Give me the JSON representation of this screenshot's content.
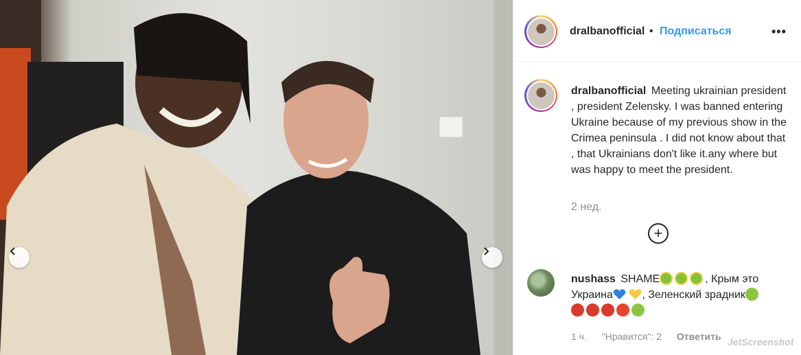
{
  "post": {
    "image_description_icon": "post-photo",
    "carousel": {
      "prev_icon": "chevron-left-icon",
      "next_icon": "chevron-right-icon"
    }
  },
  "header": {
    "username": "dralbanofficial",
    "separator": "•",
    "follow_label": "Подписаться",
    "more_label": "•••"
  },
  "caption": {
    "username": "dralbanofficial",
    "text": "Meeting ukrainian president , president Zelensky. I was banned entering Ukraine because of my previous show in the Crimea peninsula . I did not know about that , that Ukrainians don't like it.any where but was happy to meet the president.",
    "age": "2 нед."
  },
  "load_more": {
    "label": "+"
  },
  "comment": {
    "username": "nushass",
    "text_part1": "SHAME",
    "text_part2": ", Крым это Украина",
    "text_part3": ", Зеленский зрадник",
    "age": "1 ч.",
    "likes": "\"Нравится\": 2",
    "reply": "Ответить"
  },
  "watermark": "JetScreenshot",
  "colors": {
    "link": "#3897f0",
    "muted": "#8e8e8e",
    "text": "#262626"
  }
}
